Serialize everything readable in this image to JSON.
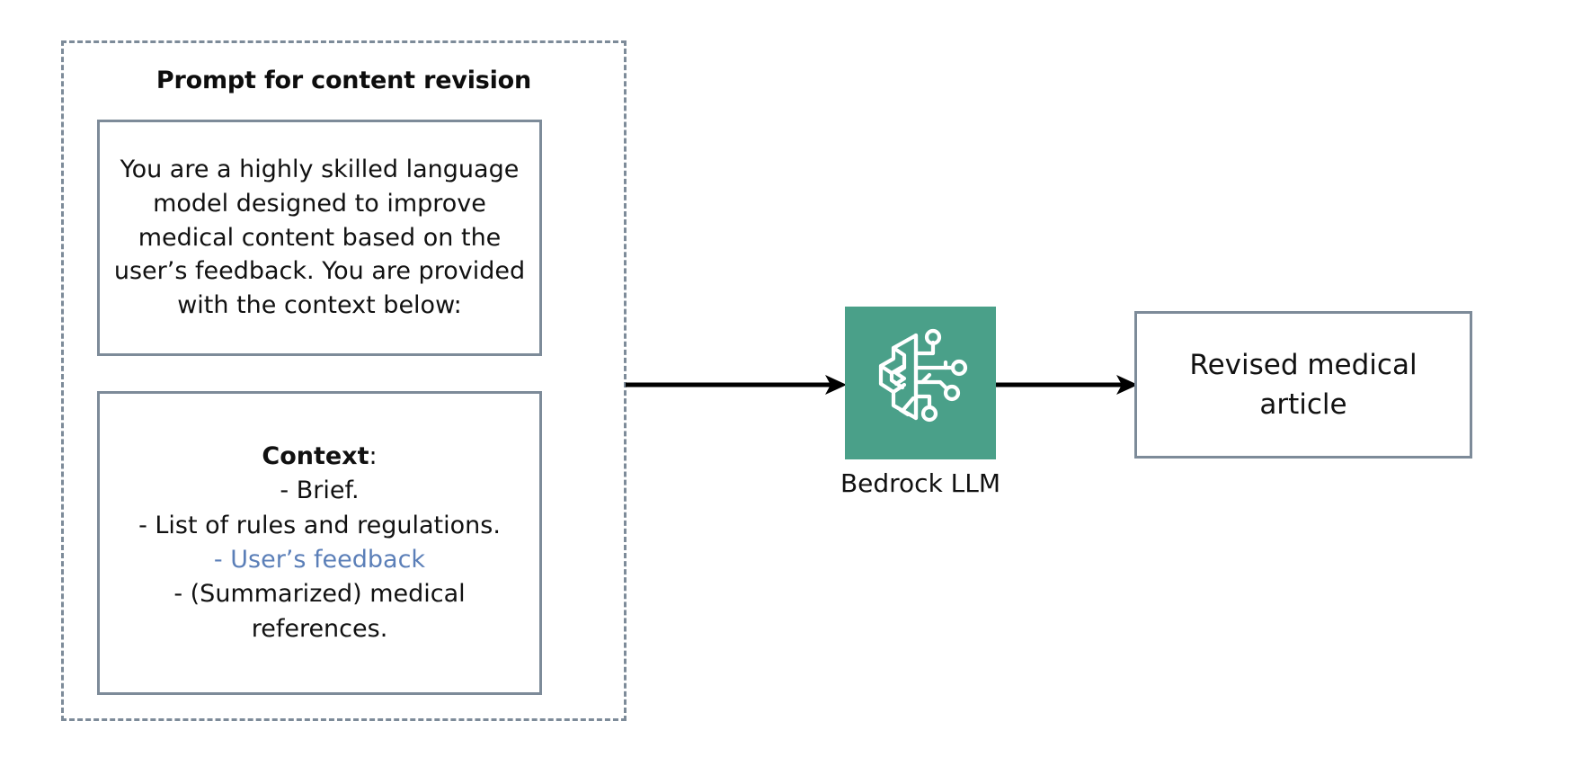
{
  "diagram": {
    "title": "Prompt for content revision",
    "prompt_group": {
      "title": "Prompt for content revision",
      "prompt_body": "You are a highly skilled language model designed to improve medical content based on the user’s feedback. You are provided with the context below:",
      "context": {
        "heading_label": "Context",
        "heading_colon": ":",
        "items": [
          {
            "text": "- Brief.",
            "accent": false
          },
          {
            "text": "- List of rules and regulations.",
            "accent": false
          },
          {
            "text": "- User’s feedback",
            "accent": true
          },
          {
            "text": "- (Summarized) medical references.",
            "accent": false
          }
        ]
      }
    },
    "llm_node": {
      "label": "Bedrock LLM",
      "icon": "brain-circuit-icon",
      "tile_color": "#4aa089"
    },
    "output_node": {
      "text": "Revised medical article"
    },
    "arrows": [
      {
        "name": "arrow-prompt-to-llm",
        "from": "prompt-group",
        "to": "llm-node"
      },
      {
        "name": "arrow-llm-to-output",
        "from": "llm-node",
        "to": "output-box"
      }
    ],
    "colors": {
      "border": "#7d8b99",
      "accent_text": "#5b7fb8",
      "brand_green": "#4aa089",
      "text": "#111111"
    }
  }
}
